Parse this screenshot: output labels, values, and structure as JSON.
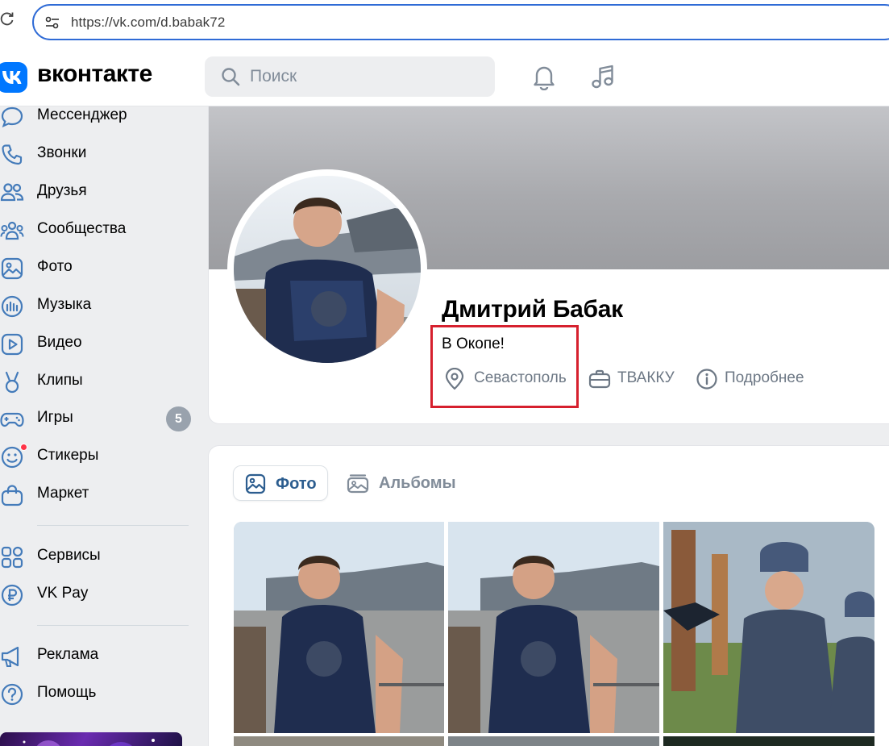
{
  "browser": {
    "url": "https://vk.com/d.babak72"
  },
  "header": {
    "logo_text": "вконтакте",
    "search_placeholder": "Поиск"
  },
  "sidebar": {
    "items": [
      {
        "label": "Мессенджер",
        "icon": "messenger-icon"
      },
      {
        "label": "Звонки",
        "icon": "phone-icon"
      },
      {
        "label": "Друзья",
        "icon": "friends-icon"
      },
      {
        "label": "Сообщества",
        "icon": "communities-icon"
      },
      {
        "label": "Фото",
        "icon": "photo-icon"
      },
      {
        "label": "Музыка",
        "icon": "music-bars-icon"
      },
      {
        "label": "Видео",
        "icon": "video-icon"
      },
      {
        "label": "Клипы",
        "icon": "clips-icon"
      },
      {
        "label": "Игры",
        "icon": "gamepad-icon",
        "badge": "5"
      },
      {
        "label": "Стикеры",
        "icon": "sticker-icon"
      },
      {
        "label": "Маркет",
        "icon": "market-icon"
      },
      {
        "label": "Сервисы",
        "icon": "services-icon"
      },
      {
        "label": "VK Pay",
        "icon": "vkpay-icon"
      },
      {
        "label": "Реклама",
        "icon": "ads-icon"
      },
      {
        "label": "Помощь",
        "icon": "help-icon"
      }
    ]
  },
  "profile": {
    "name": "Дмитрий Бабак",
    "status": "В Окопе!",
    "city": "Севастополь",
    "work": "ТВАККУ",
    "more": "Подробнее"
  },
  "photos": {
    "tabs": [
      {
        "label": "Фото",
        "active": true
      },
      {
        "label": "Альбомы",
        "active": false
      }
    ]
  },
  "colors": {
    "accent": "#0077ff",
    "highlight": "#d6202e",
    "secondary_text": "#6d7885",
    "active_tab_text": "#2c5d8f"
  }
}
